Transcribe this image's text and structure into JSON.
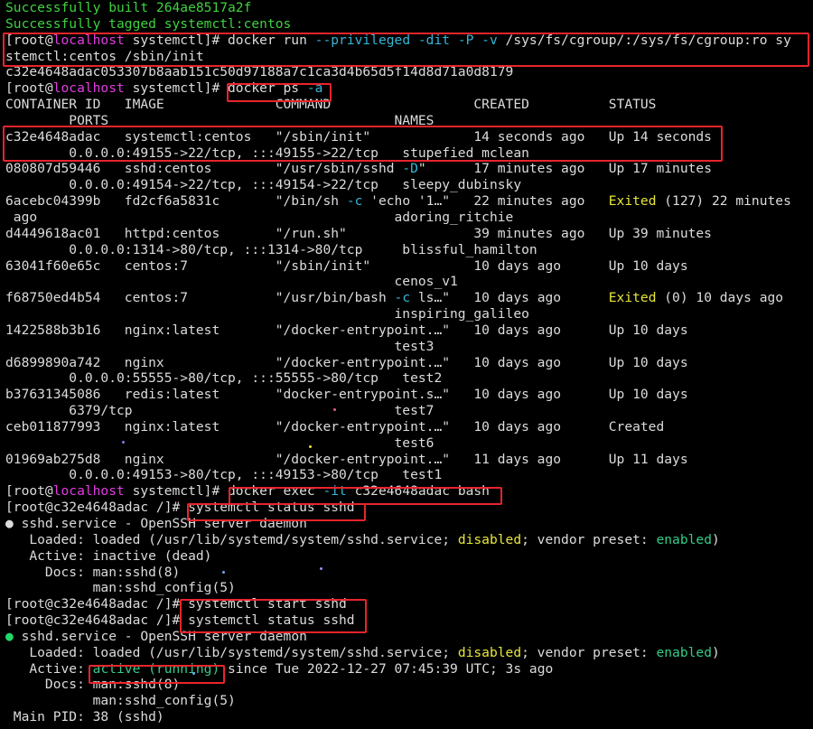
{
  "colors": {
    "background": "#000000",
    "text": "#dcdcdc",
    "success_green": "#3fd23f",
    "hostname_magenta": "#e23ce2",
    "flag_cyan": "#35b7d8",
    "warning_yellow": "#e6e63a",
    "enabled_green": "#33cc88",
    "highlight_red": "#e8242c"
  },
  "lines": [
    [
      [
        "ok",
        "Successfully built 264ae8517a2f"
      ]
    ],
    [
      [
        "ok",
        "Successfully tagged systemctl:centos"
      ]
    ],
    [
      [
        "t",
        "[root@"
      ],
      [
        "mag",
        "localhost"
      ],
      [
        "t",
        " systemctl]# docker run "
      ],
      [
        "cyan",
        "--privileged -dit -P -v"
      ],
      [
        "t",
        " /sys/fs/cgroup/:/sys/fs/cgroup:ro sy"
      ]
    ],
    [
      [
        "t",
        "stemctl:centos /sbin/init"
      ]
    ],
    [
      [
        "t",
        "c32e4648adac053307b8aab151c50d97188a7c1ca3d4b65d5f14d8d71a0d8179"
      ]
    ],
    [
      [
        "t",
        "[root@"
      ],
      [
        "mag",
        "localhost"
      ],
      [
        "t",
        " systemctl]# docker ps "
      ],
      [
        "cyan",
        "-a"
      ]
    ],
    [
      [
        "t",
        "CONTAINER ID   IMAGE              COMMAND                  CREATED          STATUS"
      ]
    ],
    [
      [
        "t",
        "        PORTS                                    NAMES"
      ]
    ],
    [
      [
        "t",
        "c32e4648adac   systemctl:centos   \"/sbin/init\"             14 seconds ago   Up 14 seconds"
      ]
    ],
    [
      [
        "t",
        "        0.0.0.0:49155->22/tcp, :::49155->22/tcp   stupefied_mclean"
      ]
    ],
    [
      [
        "t",
        "080807d59446   sshd:centos        \"/usr/sbin/sshd "
      ],
      [
        "cyan",
        "-D"
      ],
      [
        "t",
        "\"      17 minutes ago   Up 17 minutes"
      ]
    ],
    [
      [
        "t",
        "        0.0.0.0:49154->22/tcp, :::49154->22/tcp   sleepy_dubinsky"
      ]
    ],
    [
      [
        "t",
        "6acebc04399b   fd2cf6a5831c       \"/bin/sh "
      ],
      [
        "cyan",
        "-c"
      ],
      [
        "t",
        " 'echo '1…\"   22 minutes ago   "
      ],
      [
        "yellow",
        "Exited"
      ],
      [
        "t",
        " (127) 22 minutes"
      ]
    ],
    [
      [
        "t",
        " ago                                             adoring_ritchie"
      ]
    ],
    [
      [
        "t",
        "d4449618ac01   httpd:centos       \"/run.sh\"                39 minutes ago   Up 39 minutes"
      ]
    ],
    [
      [
        "t",
        "        0.0.0.0:1314->80/tcp, :::1314->80/tcp     blissful_hamilton"
      ]
    ],
    [
      [
        "t",
        "63041f60e65c   centos:7           \"/sbin/init\"             10 days ago      Up 10 days"
      ]
    ],
    [
      [
        "t",
        "                                                 cenos_v1"
      ]
    ],
    [
      [
        "t",
        "f68750ed4b54   centos:7           \"/usr/bin/bash "
      ],
      [
        "cyan",
        "-c"
      ],
      [
        "t",
        " ls…\"   10 days ago      "
      ],
      [
        "yellow",
        "Exited"
      ],
      [
        "t",
        " (0) 10 days ago"
      ]
    ],
    [
      [
        "t",
        "                                                 inspiring_galileo"
      ]
    ],
    [
      [
        "t",
        "1422588b3b16   nginx:latest       \"/docker-entrypoint.…\"   10 days ago      Up 10 days"
      ]
    ],
    [
      [
        "t",
        "                                                 test3"
      ]
    ],
    [
      [
        "t",
        "d6899890a742   nginx              \"/docker-entrypoint.…\"   10 days ago      Up 10 days"
      ]
    ],
    [
      [
        "t",
        "        0.0.0.0:55555->80/tcp, :::55555->80/tcp   test2"
      ]
    ],
    [
      [
        "t",
        "b37631345086   redis:latest       \"docker-entrypoint.s…\"   10 days ago      Up 10 days"
      ]
    ],
    [
      [
        "t",
        "        6379/tcp                                 test7"
      ]
    ],
    [
      [
        "t",
        "ceb011877993   nginx:latest       \"/docker-entrypoint.…\"   10 days ago      Created"
      ]
    ],
    [
      [
        "t",
        "                                                 test6"
      ]
    ],
    [
      [
        "t",
        "01969ab275d8   nginx              \"/docker-entrypoint.…\"   11 days ago      Up 11 days"
      ]
    ],
    [
      [
        "t",
        "        0.0.0.0:49153->80/tcp, :::49153->80/tcp   test1"
      ]
    ],
    [
      [
        "t",
        "[root@"
      ],
      [
        "mag",
        "localhost"
      ],
      [
        "t",
        " systemctl]# docker exec "
      ],
      [
        "cyan",
        "-it"
      ],
      [
        "t",
        " c32e4648adac bash"
      ]
    ],
    [
      [
        "t",
        "[root@c32e4648adac /]# systemctl status sshd"
      ]
    ],
    [
      [
        "t",
        "● sshd.service - OpenSSH server daemon"
      ]
    ],
    [
      [
        "t",
        "   Loaded: loaded (/usr/lib/systemd/system/sshd.service; "
      ],
      [
        "yellow",
        "disabled"
      ],
      [
        "t",
        "; vendor preset: "
      ],
      [
        "green",
        "enabled"
      ],
      [
        "t",
        ")"
      ]
    ],
    [
      [
        "t",
        "   Active: inactive (dead)"
      ]
    ],
    [
      [
        "t",
        "     Docs: man:sshd(8)"
      ]
    ],
    [
      [
        "t",
        "           man:sshd_config(5)"
      ]
    ],
    [
      [
        "t",
        "[root@c32e4648adac /]# systemctl start sshd"
      ]
    ],
    [
      [
        "t",
        "[root@c32e4648adac /]# systemctl status sshd"
      ]
    ],
    [
      [
        "dotgreen",
        "●"
      ],
      [
        "t",
        " sshd.service - OpenSSH server daemon"
      ]
    ],
    [
      [
        "t",
        "   Loaded: loaded (/usr/lib/systemd/system/sshd.service; "
      ],
      [
        "yellow",
        "disabled"
      ],
      [
        "t",
        "; vendor preset: "
      ],
      [
        "green",
        "enabled"
      ],
      [
        "t",
        ")"
      ]
    ],
    [
      [
        "t",
        "   Active: "
      ],
      [
        "green",
        "active (running)"
      ],
      [
        "t",
        " since Tue 2022-12-27 07:45:39 UTC; 3s ago"
      ]
    ],
    [
      [
        "t",
        "     Docs: man:sshd(8)"
      ]
    ],
    [
      [
        "t",
        "           man:sshd_config(5)"
      ]
    ],
    [
      [
        "t",
        " Main PID: 38 (sshd)"
      ]
    ]
  ]
}
